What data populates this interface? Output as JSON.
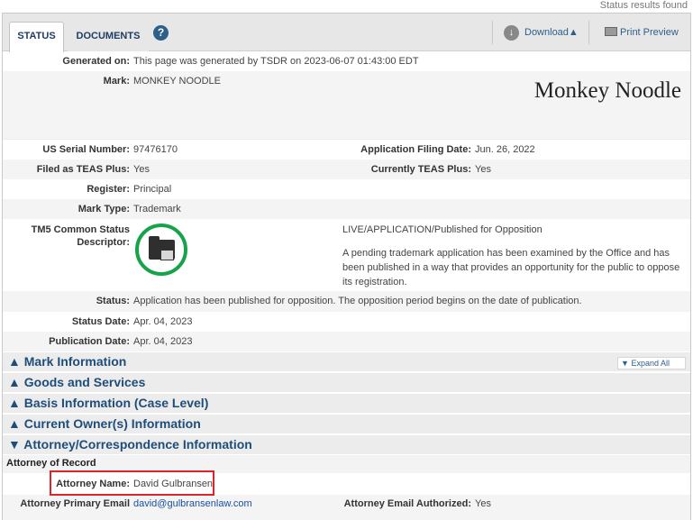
{
  "top_note": "Status results found",
  "tabs": [
    {
      "label": "STATUS"
    },
    {
      "label": "DOCUMENTS"
    }
  ],
  "toolbar": {
    "download": "Download",
    "print_preview": "Print Preview"
  },
  "status": {
    "generated_on_label": "Generated on:",
    "generated_on": "This page was generated by TSDR on 2023-06-07 01:43:00 EDT",
    "mark_label": "Mark:",
    "mark": "MONKEY NOODLE",
    "mark_display": "Monkey Noodle",
    "serial_label": "US Serial Number:",
    "serial": "97476170",
    "filing_date_label": "Application Filing Date:",
    "filing_date": "Jun. 26, 2022",
    "teas_plus_label": "Filed as TEAS Plus:",
    "teas_plus": "Yes",
    "current_teas_label": "Currently TEAS Plus:",
    "current_teas": "Yes",
    "register_label": "Register:",
    "register": "Principal",
    "mark_type_label": "Mark Type:",
    "mark_type": "Trademark",
    "tm5_label": "TM5 Common Status Descriptor:",
    "tm5_status": "LIVE/APPLICATION/Published for Opposition",
    "tm5_desc": "A pending trademark application has been examined by the Office and has been published in a way that provides an opportunity for the public to oppose its registration.",
    "status_label": "Status:",
    "status_text": "Application has been published for opposition. The opposition period begins on the date of publication.",
    "status_date_label": "Status Date:",
    "status_date": "Apr. 04, 2023",
    "pub_date_label": "Publication Date:",
    "pub_date": "Apr. 04, 2023"
  },
  "sections": [
    {
      "title": "Mark Information",
      "arrow": "▲"
    },
    {
      "title": "Goods and Services",
      "arrow": "▲"
    },
    {
      "title": "Basis Information (Case Level)",
      "arrow": "▲"
    },
    {
      "title": "Current Owner(s) Information",
      "arrow": "▲"
    },
    {
      "title": "Attorney/Correspondence Information",
      "arrow": "▼"
    }
  ],
  "expand_all": "Expand All",
  "attorney": {
    "heading": "Attorney of Record",
    "name_label": "Attorney Name:",
    "name": "David Gulbransen",
    "email_label": "Attorney Primary Email",
    "email": "david@gulbransenlaw.com",
    "email_auth_label": "Attorney Email Authorized:",
    "email_auth": "Yes"
  }
}
